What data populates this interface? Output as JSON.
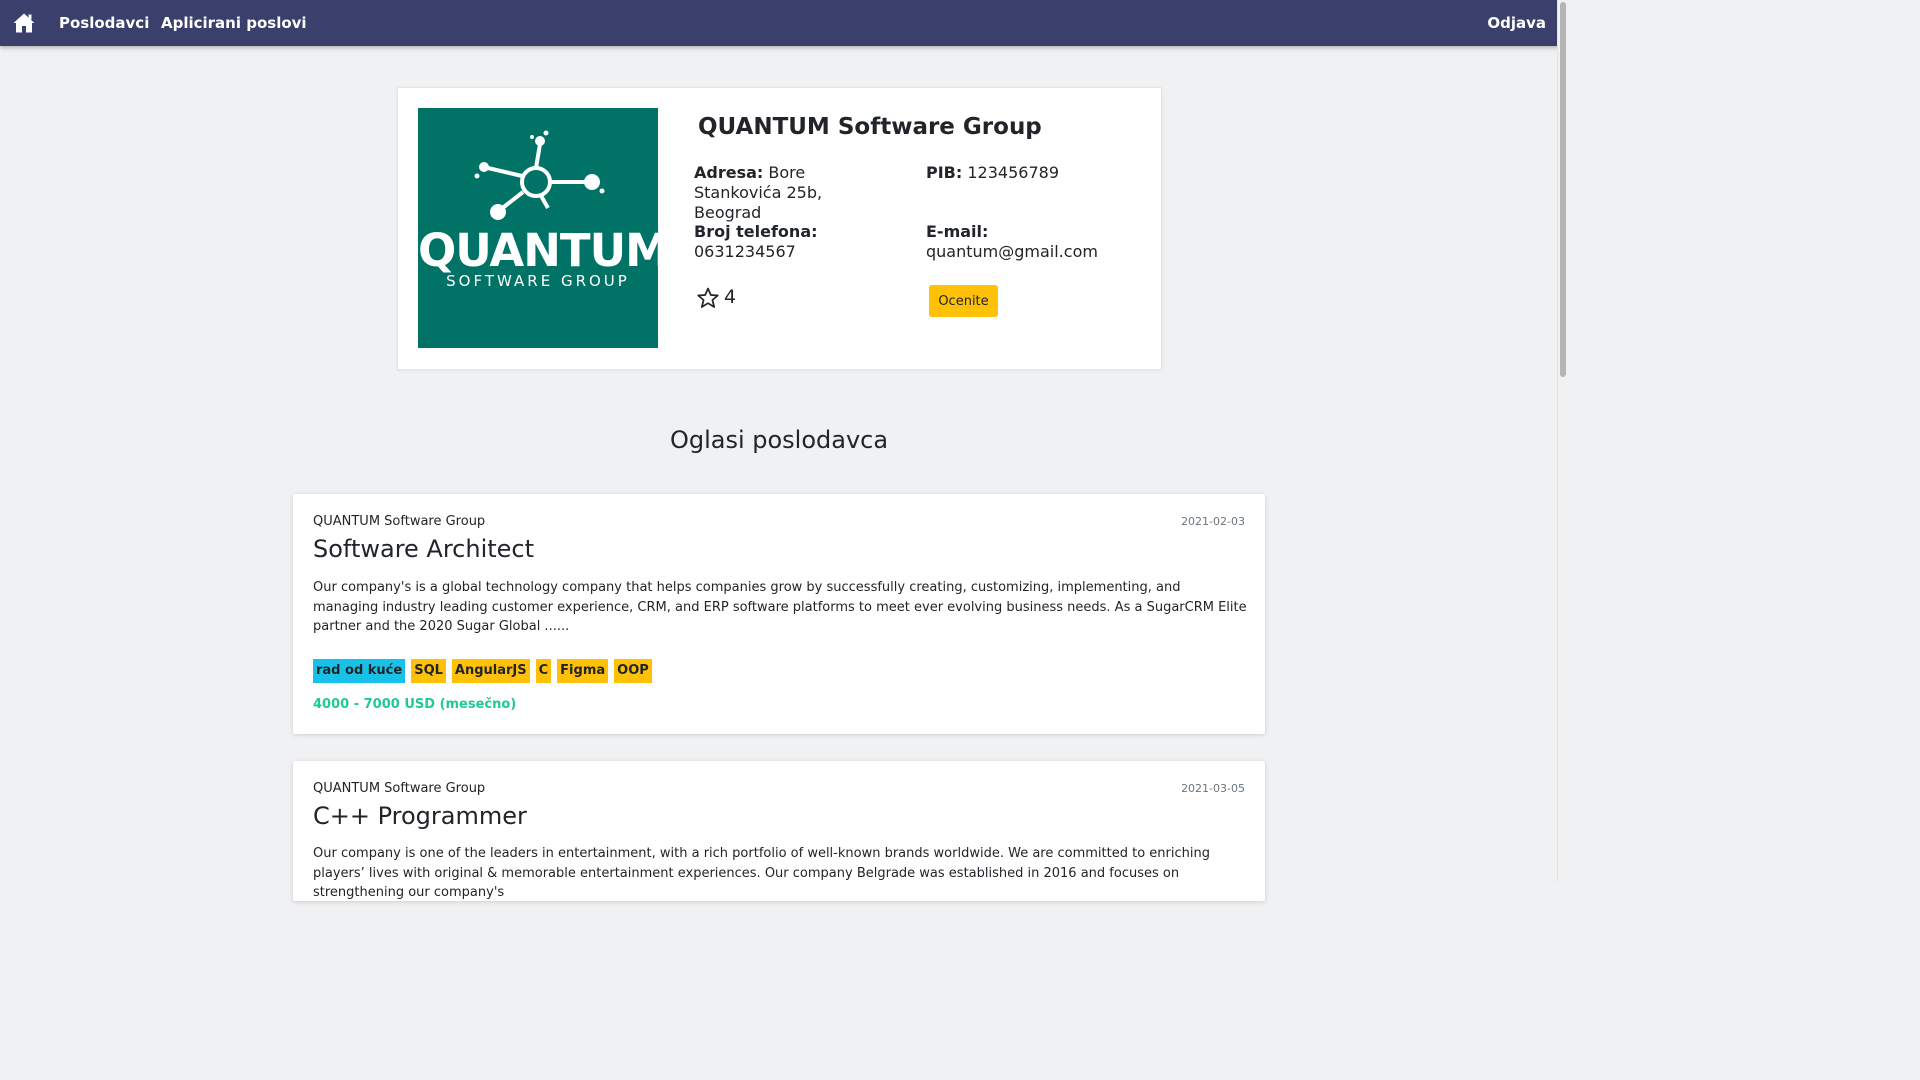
{
  "nav": {
    "home_icon": "home-icon",
    "links": [
      "Poslodavci",
      "Aplicirani poslovi"
    ],
    "logout": "Odjava"
  },
  "employer": {
    "logo": {
      "word": "QUANTUM",
      "sub": "SOFTWARE GROUP",
      "bg_color": "#007366"
    },
    "name": "QUANTUM Software Group",
    "address_label": "Adresa:",
    "address_value": "Bore Stankovića 25b, Beograd",
    "pib_label": "PIB:",
    "pib_value": "123456789",
    "phone_label": "Broj telefona:",
    "phone_value": "0631234567",
    "email_label": "E-mail:",
    "email_value": "quantum@gmail.com",
    "rating_icon": "star-outline-icon",
    "rating": "4",
    "rate_button": "Ocenite"
  },
  "section_title": "Oglasi poslodavca",
  "jobs": [
    {
      "company": "QUANTUM Software Group",
      "date": "2021-02-03",
      "title": "Software Architect",
      "description": "Our company's is a global technology company that helps companies grow by successfully creating, customizing, implementing, and managing industry leading customer experience, CRM, and ERP software platforms to meet ever evolving business needs. As a SugarCRM Elite partner and the 2020 Sugar Global ......",
      "work_type": "rad od kuće",
      "skills": [
        "SQL",
        "AngularJS",
        "C",
        "Figma",
        "OOP"
      ],
      "salary": "4000 - 7000 USD (mesečno)"
    },
    {
      "company": "QUANTUM Software Group",
      "date": "2021-03-05",
      "title": "C++ Programmer",
      "description": "Our company is one of the leaders in entertainment, with a rich portfolio of well-known brands worldwide. We are committed to enriching players’ lives with original & memorable entertainment experiences. Our company Belgrade was established in 2016 and focuses on strengthening our company's"
    }
  ],
  "colors": {
    "navbar": "#3a3f6b",
    "accent_yellow": "#ffc107",
    "work_type_tag": "#17c1e8",
    "salary_green": "#20c997"
  }
}
